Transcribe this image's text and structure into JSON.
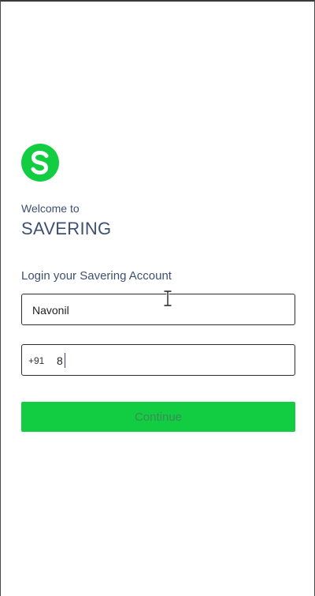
{
  "welcome": {
    "subtitle": "Welcome to",
    "brand": "SAVERING"
  },
  "login": {
    "heading": "Login your Savering Account",
    "name_value": "Navonil",
    "country_code": "+91",
    "phone_value": "8",
    "continue_label": "Continue"
  },
  "colors": {
    "brand_green": "#12cc42",
    "heading_text": "#3e5070"
  },
  "icons": {
    "logo": "savering-s-logo-icon",
    "cursor": "text-cursor-icon"
  }
}
